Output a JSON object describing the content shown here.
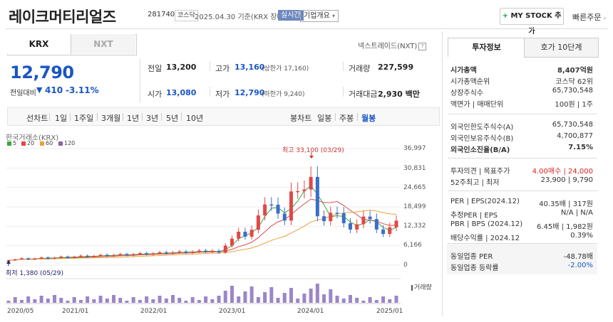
{
  "header": {
    "company": "레이크머티리얼즈",
    "code": "281740",
    "market": "코스닥",
    "date": "2025.04.30",
    "date_suffix": "기준(KRX 장마감)",
    "live": "실시간",
    "corp_info": "기업개요",
    "my_stock": "MY STOCK 추가",
    "quick_order": "빠른주문"
  },
  "exchange_tabs": [
    "KRX",
    "NXT"
  ],
  "nxt_link": "넥스트레이드(NXT)",
  "quote": {
    "price": "12,790",
    "change_label": "전일대비",
    "change_value": "410",
    "change_rate": "-3.11%",
    "prev_close_label": "전일",
    "prev_close": "13,200",
    "high_label": "고가",
    "high": "13,160",
    "upper_limit": "(상한가 17,160)",
    "volume_label": "거래량",
    "volume": "227,599",
    "open_label": "시가",
    "open": "13,080",
    "low_label": "저가",
    "low": "12,790",
    "lower_limit": "(하한가 9,240)",
    "amount_label": "거래대금",
    "amount": "2,930 백만"
  },
  "periods": [
    "선차트",
    "1일",
    "1주일",
    "3개월",
    "1년",
    "3년",
    "5년",
    "10년"
  ],
  "candle_types": [
    "봉차트",
    "일봉",
    "주봉",
    "월봉"
  ],
  "chart": {
    "source": "한국거래소(KRX)",
    "legend": [
      {
        "label": "5",
        "color": "#3aa83a"
      },
      {
        "label": "20",
        "color": "#e04848"
      },
      {
        "label": "60",
        "color": "#e8a23a"
      },
      {
        "label": "120",
        "color": "#8a5fb5"
      }
    ],
    "high_note": "최고 33,100 (03/29)",
    "low_note": "최저 1,380 (05/29)",
    "volume_label": "거래량"
  },
  "chart_data": {
    "type": "candlestick",
    "yticks": [
      "36,997",
      "30,831",
      "24,665",
      "18,499",
      "12,332",
      "6,166",
      "0"
    ],
    "ylim": [
      0,
      36997
    ],
    "xticks": [
      "2020/05",
      "2021/01",
      "2022/01",
      "2023/01",
      "2024/01",
      "2025/01"
    ],
    "max": 33100,
    "min": 1380
  },
  "right_panel": {
    "tabs": [
      "투자정보",
      "호가 10단계"
    ],
    "rows": [
      {
        "l": "시가총액",
        "r": "8,407억원",
        "bold": true
      },
      {
        "l": "시가총액순위",
        "r": "코스닥 62위"
      },
      {
        "l": "상장주식수",
        "r": "65,730,548"
      },
      {
        "l": "액면가 | 매매단위",
        "r": "100원 | 1주"
      },
      {
        "l": "외국인한도주식수(A)",
        "r": "65,730,548"
      },
      {
        "l": "외국인보유주식수(B)",
        "r": "4,700,877"
      },
      {
        "l": "외국인소진율(B/A)",
        "r": "7.15%",
        "bold": true
      },
      {
        "l": "투자의견 | 목표주가",
        "r": "4.00매수 | 24,000",
        "red": true
      },
      {
        "l": "52주최고 | 최저",
        "r": "23,900 | 9,790"
      },
      {
        "l": "PER | EPS(2024.12)",
        "r": "40.35배 | 317원"
      },
      {
        "l": "추정PER | EPS",
        "r": "N/A | N/A"
      },
      {
        "l": "PBR | BPS (2024.12)",
        "r": "6.45배 | 1,982원"
      },
      {
        "l": "배당수익률 | 2024.12",
        "r": "0.39%"
      },
      {
        "l": "동일업종 PER",
        "r": "-48.78배"
      },
      {
        "l": "동일업종 등락률",
        "r": "-2.00%",
        "blue": true
      }
    ]
  }
}
